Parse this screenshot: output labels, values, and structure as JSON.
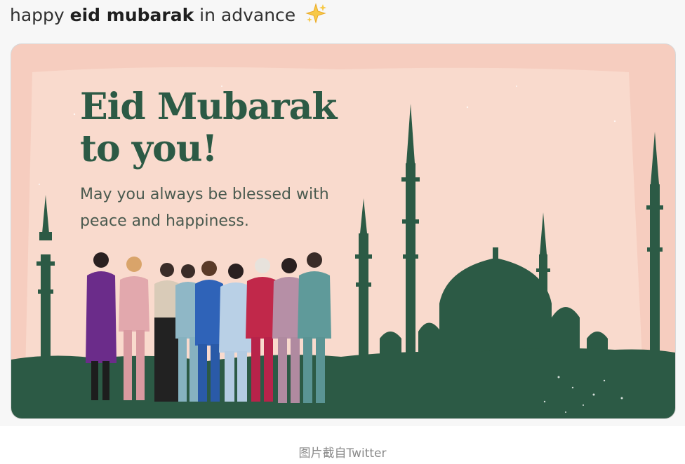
{
  "tweet": {
    "text_before": "happy ",
    "text_bold": "eid mubarak",
    "text_after": " in advance",
    "emoji_icon": "sparkles-icon"
  },
  "card": {
    "headline_line1": "Eid Mubarak",
    "headline_line2": "to you!",
    "wish_line1": "May you always be blessed with",
    "wish_line2": "peace and happiness.",
    "colors": {
      "background": "#f6cdbf",
      "paper": "#f9dccf",
      "silhouette": "#2c5a45",
      "headline": "#2c5a45"
    },
    "photo_people_count": 9
  },
  "caption": "图片截自Twitter"
}
